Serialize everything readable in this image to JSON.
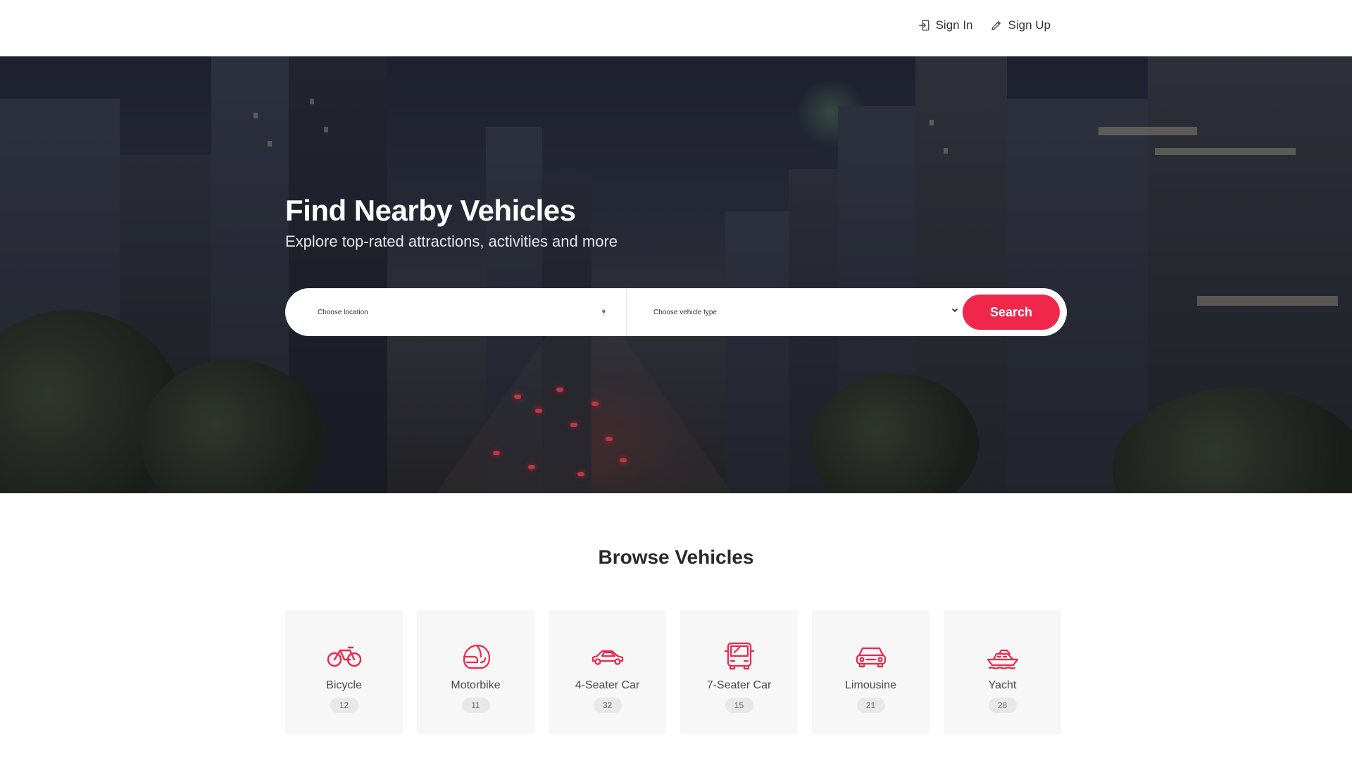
{
  "header": {
    "sign_in_label": "Sign In",
    "sign_up_label": "Sign Up"
  },
  "hero": {
    "title": "Find Nearby Vehicles",
    "subtitle": "Explore top-rated attractions, activities and more"
  },
  "search": {
    "location_placeholder": "Choose location",
    "vehicle_type_selected": "Choose vehicle type",
    "button_label": "Search"
  },
  "browse": {
    "title": "Browse Vehicles",
    "categories": [
      {
        "name": "Bicycle",
        "count": "12",
        "icon": "bicycle-icon"
      },
      {
        "name": "Motorbike",
        "count": "11",
        "icon": "helmet-icon"
      },
      {
        "name": "4-Seater Car",
        "count": "32",
        "icon": "car-icon"
      },
      {
        "name": "7-Seater Car",
        "count": "15",
        "icon": "van-icon"
      },
      {
        "name": "Limousine",
        "count": "21",
        "icon": "limousine-icon"
      },
      {
        "name": "Yacht",
        "count": "28",
        "icon": "yacht-icon"
      }
    ]
  },
  "colors": {
    "accent": "#f0264a",
    "card_bg": "#f7f7f7",
    "badge_bg": "#e8e8e8"
  }
}
